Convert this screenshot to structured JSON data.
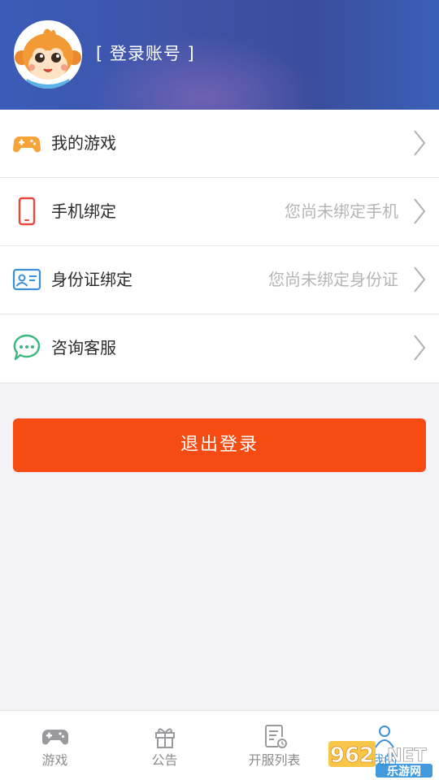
{
  "header": {
    "login_label": "[ 登录账号 ]"
  },
  "menu": [
    {
      "label": "我的游戏",
      "status": "",
      "icon": "gamepad-icon"
    },
    {
      "label": "手机绑定",
      "status": "您尚未绑定手机",
      "icon": "phone-icon"
    },
    {
      "label": "身份证绑定",
      "status": "您尚未绑定身份证",
      "icon": "id-card-icon"
    },
    {
      "label": "咨询客服",
      "status": "",
      "icon": "chat-bubble-icon"
    }
  ],
  "logout_label": "退出登录",
  "tabs": [
    {
      "label": "游戏",
      "icon": "gamepad-icon",
      "active": false
    },
    {
      "label": "公告",
      "icon": "gift-icon",
      "active": false
    },
    {
      "label": "开服列表",
      "icon": "schedule-list-icon",
      "active": false
    },
    {
      "label": "我的",
      "icon": "user-icon",
      "active": true
    }
  ],
  "watermark": {
    "number": "962",
    "suffix": ".NET",
    "sub": "乐游网"
  },
  "colors": {
    "header_blue": "#3f54a8",
    "logout_orange": "#f64b12",
    "active_tab_blue": "#3f8fd6",
    "gamepad_orange": "#f4a43a",
    "phone_red": "#e8483a",
    "id_blue": "#3b8fd8",
    "chat_green": "#3bb77e"
  }
}
